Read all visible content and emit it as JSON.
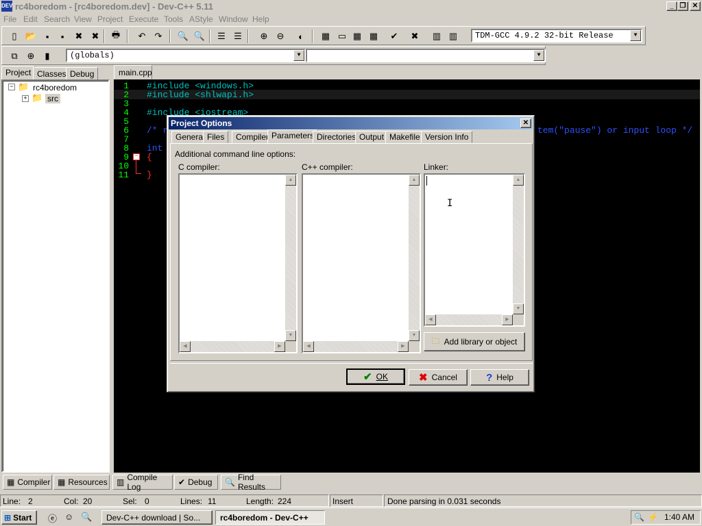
{
  "window": {
    "title": "rc4boredom - [rc4boredom.dev] - Dev-C++ 5.11",
    "icon_text": "DEV"
  },
  "menu": [
    "File",
    "Edit",
    "Search",
    "View",
    "Project",
    "Execute",
    "Tools",
    "AStyle",
    "Window",
    "Help"
  ],
  "toolbar": {
    "compiler_select": "TDM-GCC 4.9.2 32-bit Release",
    "scope_select": "(globals)",
    "member_select": ""
  },
  "left_panel": {
    "tabs": [
      "Project",
      "Classes",
      "Debug"
    ],
    "tree": {
      "root": "rc4boredom",
      "child": "src"
    }
  },
  "editor": {
    "tab": "main.cpp",
    "lines": [
      {
        "n": "1",
        "text": "#include <windows.h>"
      },
      {
        "n": "2",
        "text": "#include <shlwapi.h>"
      },
      {
        "n": "3",
        "text": ""
      },
      {
        "n": "4",
        "text": "#include <iostream>"
      },
      {
        "n": "5",
        "text": ""
      },
      {
        "n": "6",
        "text": "/* r"
      },
      {
        "n": "7",
        "text": ""
      },
      {
        "n": "8",
        "text": "int"
      },
      {
        "n": "9",
        "text": "{"
      },
      {
        "n": "10",
        "text": ""
      },
      {
        "n": "11",
        "text": "}"
      }
    ],
    "line6_tail": "tem(\"pause\") or input loop */"
  },
  "dialog": {
    "title": "Project Options",
    "tabs": [
      "General",
      "Files",
      "Compiler",
      "Parameters",
      "Directories",
      "Output",
      "Makefile",
      "Version Info"
    ],
    "active_tab": "Parameters",
    "heading": "Additional command line options:",
    "c_label": "C compiler:",
    "cpp_label": "C++ compiler:",
    "linker_label": "Linker:",
    "c_value": "",
    "cpp_value": "",
    "linker_value": "",
    "add_lib_button": "Add library or object",
    "ok": "OK",
    "cancel": "Cancel",
    "help": "Help"
  },
  "bottom_tabs": [
    "Compiler",
    "Resources",
    "Compile Log",
    "Debug",
    "Find Results"
  ],
  "statusbar": {
    "line_label": "Line:",
    "line_val": "2",
    "col_label": "Col:",
    "col_val": "20",
    "sel_label": "Sel:",
    "sel_val": "0",
    "lines_label": "Lines:",
    "lines_val": "11",
    "length_label": "Length:",
    "length_val": "224",
    "mode": "Insert",
    "message": "Done parsing in 0.031 seconds"
  },
  "taskbar": {
    "start": "Start",
    "tasks": [
      "Dev-C++ download | So...",
      "rc4boredom - Dev-C++"
    ],
    "clock": "1:40 AM"
  }
}
